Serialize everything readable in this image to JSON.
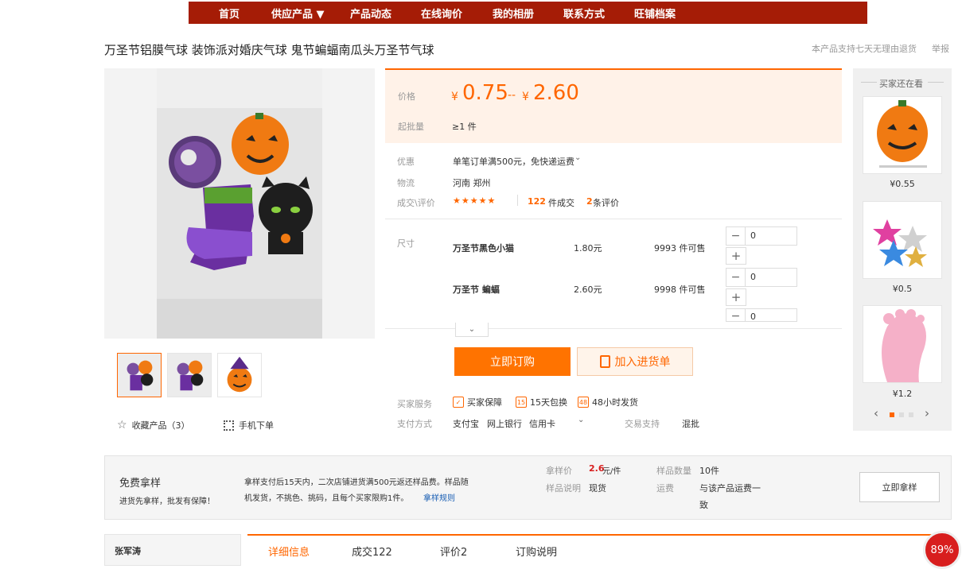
{
  "nav": {
    "items": [
      "首页",
      "供应产品 ▼",
      "产品动态",
      "在线询价",
      "我的相册",
      "联系方式",
      "旺铺档案"
    ]
  },
  "product": {
    "title": "万圣节铝膜气球 装饰派对婚庆气球 鬼节蝙蝠南瓜头万圣节气球",
    "return_policy": "本产品支持七天无理由退货",
    "report": "举报"
  },
  "price": {
    "label": "价格",
    "currency": "¥",
    "low": "0.75",
    "sep": "--",
    "high": "2.60",
    "moq_label": "起批量",
    "moq": "≥1 件"
  },
  "info": {
    "promo_label": "优惠",
    "promo": "单笔订单满500元，免快递运费",
    "logistics_label": "物流",
    "logistics": "河南 郑州",
    "deal_label": "成交\\评价",
    "stars": "★★★★★",
    "deals_count": "122",
    "deals_suffix": "件成交",
    "reviews_count": "2",
    "reviews_suffix": "条评价"
  },
  "sku": {
    "label": "尺寸",
    "rows": [
      {
        "name": "万圣节黑色小猫",
        "price": "1.80元",
        "stock": "9993 件可售",
        "qty": "0"
      },
      {
        "name": "万圣节 蝙蝠",
        "price": "2.60元",
        "stock": "9998 件可售",
        "qty": "0"
      }
    ],
    "third_qty": "0"
  },
  "actions": {
    "buy": "立即订购",
    "cart": "加入进货单"
  },
  "service": {
    "label": "买家服务",
    "items": [
      "买家保障",
      "15天包换",
      "48小时发货"
    ],
    "pay_label": "支付方式",
    "pay_methods": [
      "支付宝",
      "网上银行",
      "信用卡"
    ],
    "trade_label": "交易支持",
    "trade": "混批"
  },
  "gallery": {
    "favorite": "收藏产品（3）",
    "mobile": "手机下单"
  },
  "also_view": {
    "title": "买家还在看",
    "items": [
      {
        "price": "¥0.55"
      },
      {
        "price": "¥0.5"
      },
      {
        "price": "¥1.2"
      }
    ]
  },
  "sample": {
    "title": "免费拿样",
    "subtitle": "进货先拿样，批发有保障！",
    "desc_1": "拿样支付后15天内，二次店铺进货满500元返还样品费。样品随",
    "desc_2": "机发货，不挑色、挑码，且每个买家限购1件。",
    "rules_link": "拿样规则",
    "price_label": "拿样价",
    "price_value": "2.6",
    "price_unit": "元/件",
    "qty_label": "样品数量",
    "qty_value": "10件",
    "desc_label": "样品说明",
    "desc_value": "现货",
    "ship_label": "运费",
    "ship_value_1": "与该产品运费一",
    "ship_value_2": "致",
    "button": "立即拿样"
  },
  "bottom": {
    "shop_name": "张军涛",
    "tabs": [
      "详细信息",
      "成交122",
      "评价2",
      "订购说明"
    ],
    "badge": "89%"
  },
  "colors": {
    "nav_bg": "#a51c06",
    "accent": "#ff6600",
    "price_bg": "#fff2e8"
  }
}
